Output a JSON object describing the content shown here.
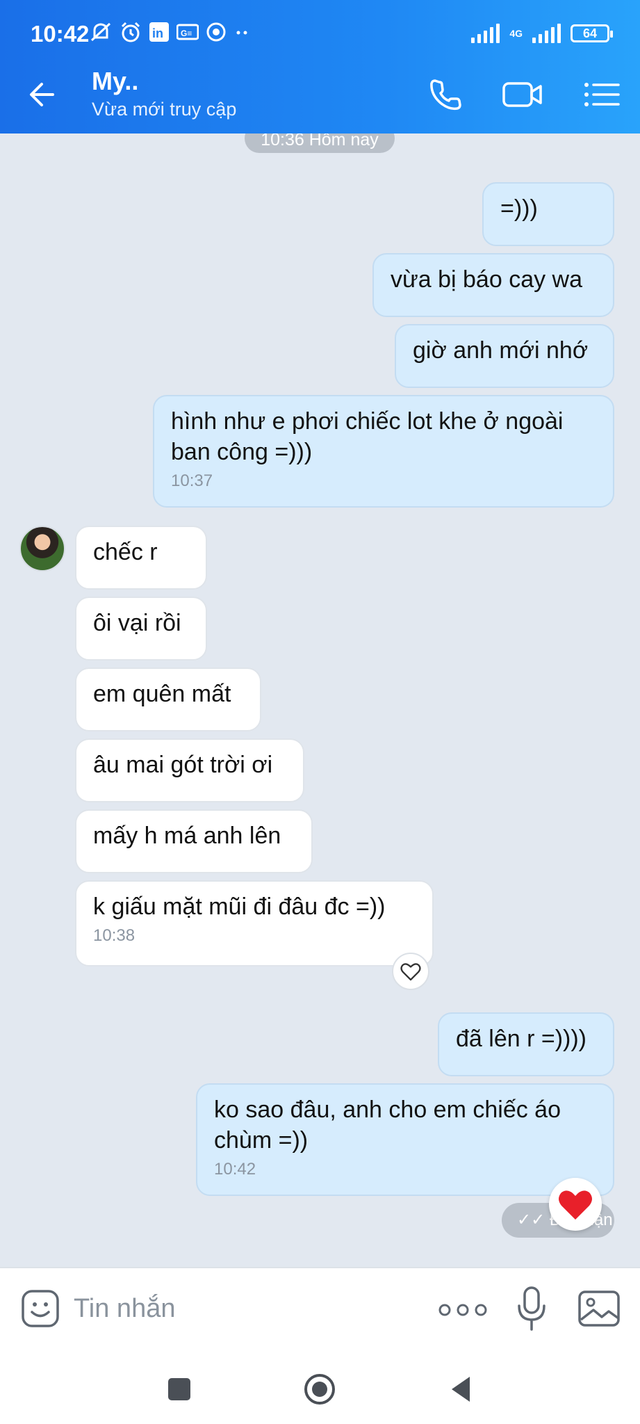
{
  "status_bar": {
    "time": "10:42",
    "network": "4G",
    "battery": "64",
    "icons": [
      "mute-icon",
      "alarm-icon",
      "linkedin-icon",
      "gmail-icon",
      "sync-icon",
      "more-dots-icon"
    ]
  },
  "header": {
    "title": "My..",
    "subtitle": "Vừa mới truy cập"
  },
  "chat": {
    "date_pill": "10:36 Hôm nay",
    "messages": [
      {
        "dir": "out",
        "text": "=)))"
      },
      {
        "dir": "out",
        "text": "vừa bị báo cay wa"
      },
      {
        "dir": "out",
        "text": "giờ anh mới nhớ"
      },
      {
        "dir": "out",
        "text": "hình như e phơi chiếc lot khe ở ngoài ban công =)))",
        "time": "10:37"
      },
      {
        "dir": "in",
        "text": "chếc r"
      },
      {
        "dir": "in",
        "text": "ôi vại rồi"
      },
      {
        "dir": "in",
        "text": "em quên mất"
      },
      {
        "dir": "in",
        "text": "âu mai gót trời ơi"
      },
      {
        "dir": "in",
        "text": "mấy h má anh lên"
      },
      {
        "dir": "in",
        "text": "k giấu mặt mũi đi đâu đc =))",
        "time": "10:38"
      },
      {
        "dir": "out",
        "text": "đã lên r =))))"
      },
      {
        "dir": "out",
        "text": "ko sao đâu, anh cho em chiếc áo chùm =))",
        "time": "10:42"
      }
    ],
    "seen_label": "Đã nhận"
  },
  "input": {
    "placeholder": "Tin nhắn"
  },
  "colors": {
    "header_start": "#1a6fe8",
    "header_end": "#29a3fb",
    "outgoing_bubble": "#d6ecfd",
    "incoming_bubble": "#ffffff",
    "heart": "#e8202a"
  }
}
